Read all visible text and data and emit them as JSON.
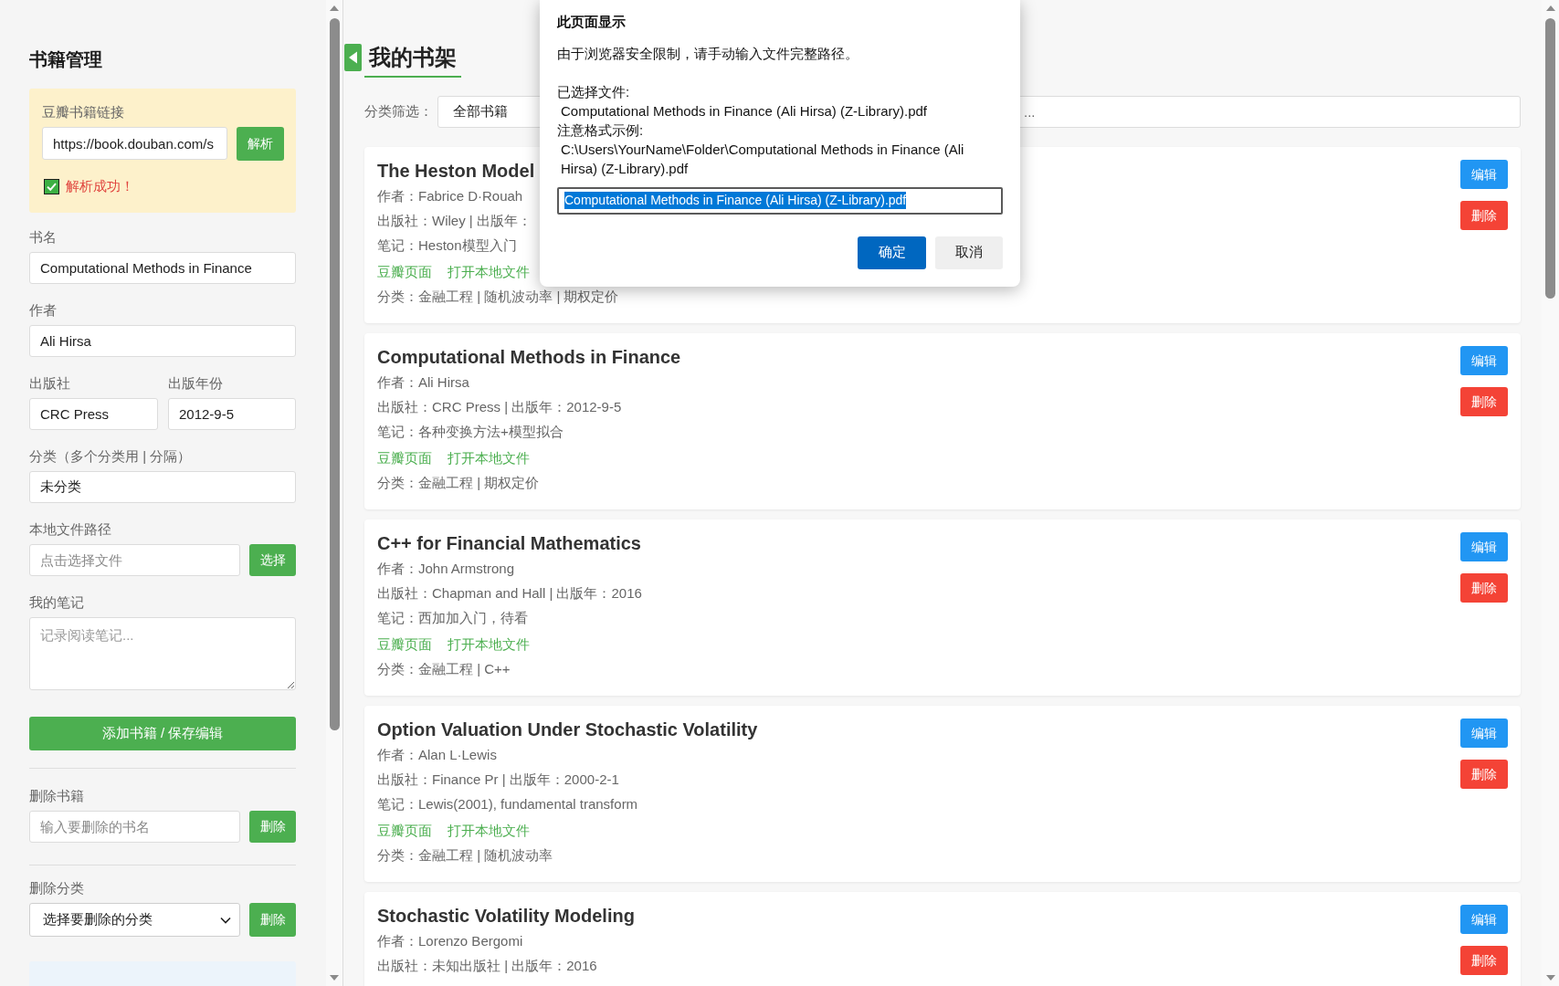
{
  "sidebar": {
    "title": "书籍管理",
    "douban": {
      "label": "豆瓣书籍链接",
      "value": "https://book.douban.com/s",
      "button": "解析",
      "message": "解析成功！"
    },
    "form": {
      "title": {
        "label": "书名",
        "value": "Computational Methods in Finance"
      },
      "author": {
        "label": "作者",
        "value": "Ali Hirsa"
      },
      "publisher": {
        "label": "出版社",
        "value": "CRC Press"
      },
      "year": {
        "label": "出版年份",
        "value": "2012-9-5"
      },
      "categories": {
        "label": "分类（多个分类用 | 分隔）",
        "value": "未分类"
      },
      "file": {
        "label": "本地文件路径",
        "placeholder": "点击选择文件",
        "button": "选择"
      },
      "notes": {
        "label": "我的笔记",
        "placeholder": "记录阅读笔记..."
      },
      "submit": "添加书籍 / 保存编辑"
    },
    "delete_book": {
      "label": "删除书籍",
      "placeholder": "输入要删除的书名",
      "button": "删除"
    },
    "delete_category": {
      "label": "删除分类",
      "value": "选择要删除的分类",
      "button": "删除"
    }
  },
  "shelf": {
    "title": "我的书架",
    "filter": {
      "label": "分类筛选：",
      "value": "全部书籍"
    },
    "search": {
      "placeholder": "..."
    },
    "books": [
      {
        "title": "The Heston Model",
        "author": "作者：Fabrice D·Rouah",
        "publisher": "出版社：Wiley | 出版年：",
        "notes": "笔记：Heston模型入门",
        "links": [
          "豆瓣页面",
          "打开本地文件"
        ],
        "categories": "分类：金融工程 | 随机波动率 | 期权定价",
        "actions": [
          {
            "label": "编辑",
            "kind": "edit"
          },
          {
            "label": "删除",
            "kind": "delete"
          }
        ]
      },
      {
        "title": "Computational Methods in Finance",
        "author": "作者：Ali Hirsa",
        "publisher": "出版社：CRC Press | 出版年：2012-9-5",
        "notes": "笔记：各种变换方法+模型拟合",
        "links": [
          "豆瓣页面",
          "打开本地文件"
        ],
        "categories": "分类：金融工程 | 期权定价",
        "actions": [
          {
            "label": "编辑",
            "kind": "edit"
          },
          {
            "label": "删除",
            "kind": "delete"
          }
        ]
      },
      {
        "title": "C++ for Financial Mathematics",
        "author": "作者：John Armstrong",
        "publisher": "出版社：Chapman and Hall | 出版年：2016",
        "notes": "笔记：西加加入门，待看",
        "links": [
          "豆瓣页面",
          "打开本地文件"
        ],
        "categories": "分类：金融工程 | C++",
        "actions": [
          {
            "label": "编辑",
            "kind": "edit"
          },
          {
            "label": "删除",
            "kind": "delete"
          }
        ]
      },
      {
        "title": "Option Valuation Under Stochastic Volatility",
        "author": "作者：Alan L·Lewis",
        "publisher": "出版社：Finance Pr | 出版年：2000-2-1",
        "notes": "笔记：Lewis(2001), fundamental transform",
        "links": [
          "豆瓣页面",
          "打开本地文件"
        ],
        "categories": "分类：金融工程 | 随机波动率",
        "actions": [
          {
            "label": "编辑",
            "kind": "edit"
          },
          {
            "label": "删除",
            "kind": "delete"
          }
        ]
      },
      {
        "title": "Stochastic Volatility Modeling",
        "author": "作者：Lorenzo Bergomi",
        "publisher": "出版社：未知出版社 | 出版年：2016",
        "actions": [
          {
            "label": "编辑",
            "kind": "edit"
          },
          {
            "label": "删除",
            "kind": "delete"
          }
        ]
      }
    ]
  },
  "dialog": {
    "title": "此页面显示",
    "message": "由于浏览器安全限制，请手动输入文件完整路径。",
    "selected_label": "已选择文件:",
    "selected_file": "Computational Methods in Finance (Ali Hirsa) (Z-Library).pdf",
    "example_label": "注意格式示例:",
    "example_path": "C:\\Users\\YourName\\Folder\\Computational Methods in Finance (Ali Hirsa) (Z-Library).pdf",
    "input": {
      "value": "Computational Methods in Finance (Ali Hirsa) (Z-Library).pdf",
      "selected": true
    },
    "ok": "确定",
    "cancel": "取消"
  }
}
